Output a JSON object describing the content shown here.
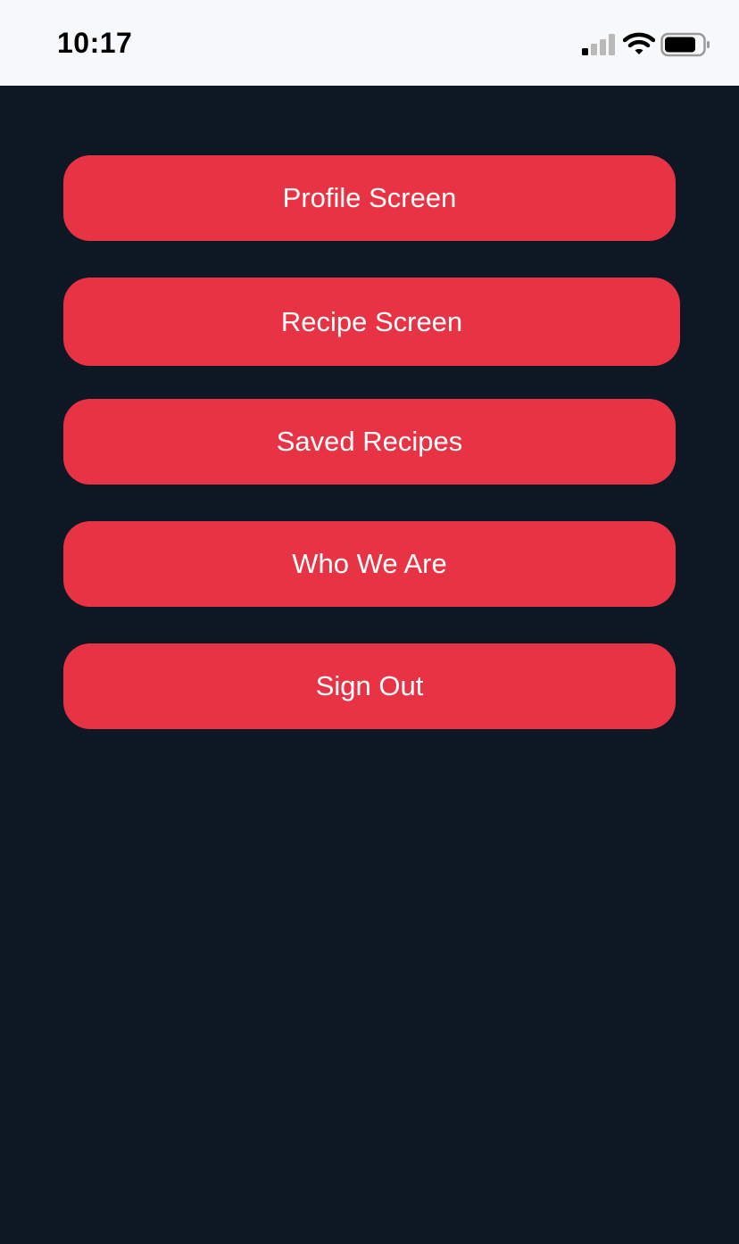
{
  "status_bar": {
    "time": "10:17",
    "icons": [
      "cellular-signal-icon",
      "wifi-icon",
      "battery-icon"
    ]
  },
  "theme": {
    "background": "#0e1724",
    "button_color": "#e83345",
    "button_text_color": "#ffffff",
    "status_bar_background": "#f7f8fa"
  },
  "menu": {
    "buttons": [
      {
        "label": "Profile Screen"
      },
      {
        "label": "Recipe Screen"
      },
      {
        "label": "Saved Recipes"
      },
      {
        "label": "Who We Are"
      },
      {
        "label": "Sign Out"
      }
    ]
  }
}
